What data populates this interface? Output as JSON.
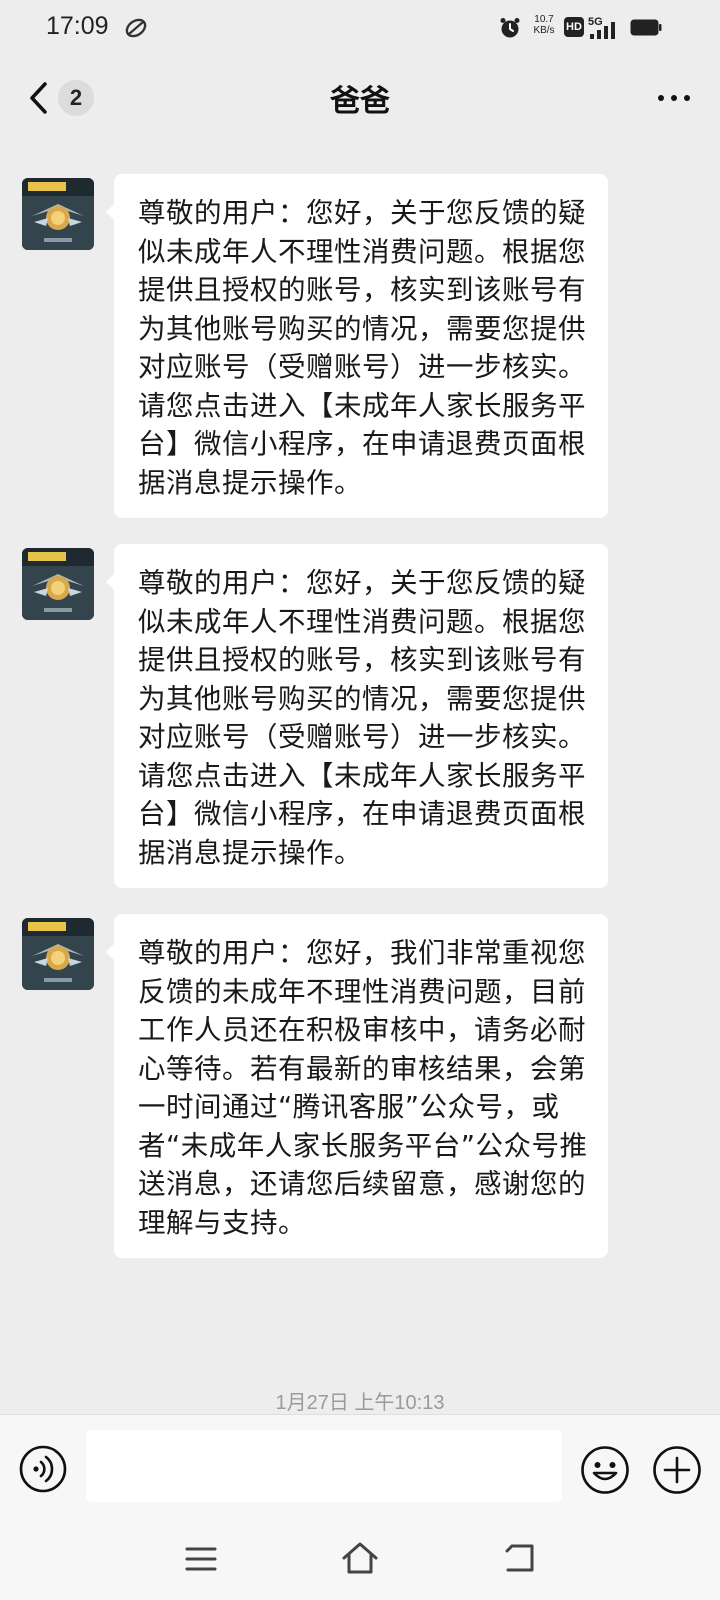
{
  "status_bar": {
    "time": "17:09",
    "net_speed_value": "10.7",
    "net_speed_unit": "KB/s",
    "hd_label": "HD",
    "network_label": "5G"
  },
  "header": {
    "unread_count": "2",
    "title": "爸爸"
  },
  "messages": [
    {
      "text": "尊敬的用户：您好，关于您反馈的疑似未成年人不理性消费问题。根据您提供且授权的账号，核实到该账号有为其他账号购买的情况，需要您提供对应账号（受赠账号）进一步核实。请您点击进入【未成年人家长服务平台】微信小程序，在申请退费页面根据消息提示操作。"
    },
    {
      "text": "尊敬的用户：您好，关于您反馈的疑似未成年人不理性消费问题。根据您提供且授权的账号，核实到该账号有为其他账号购买的情况，需要您提供对应账号（受赠账号）进一步核实。请您点击进入【未成年人家长服务平台】微信小程序，在申请退费页面根据消息提示操作。"
    },
    {
      "text": "尊敬的用户：您好，我们非常重视您反馈的未成年不理性消费问题，目前工作人员还在积极审核中，请务必耐心等待。若有最新的审核结果，会第一时间通过“腾讯客服”公众号，或者“未成年人家长服务平台”公众号推送消息，还请您后续留意，感谢您的理解与支持。"
    }
  ],
  "timestamp": "1月27日 上午10:13",
  "input": {
    "value": "",
    "placeholder": ""
  },
  "colors": {
    "background": "#ededed",
    "bubble": "#ffffff",
    "input_bar": "#f7f7f7"
  }
}
